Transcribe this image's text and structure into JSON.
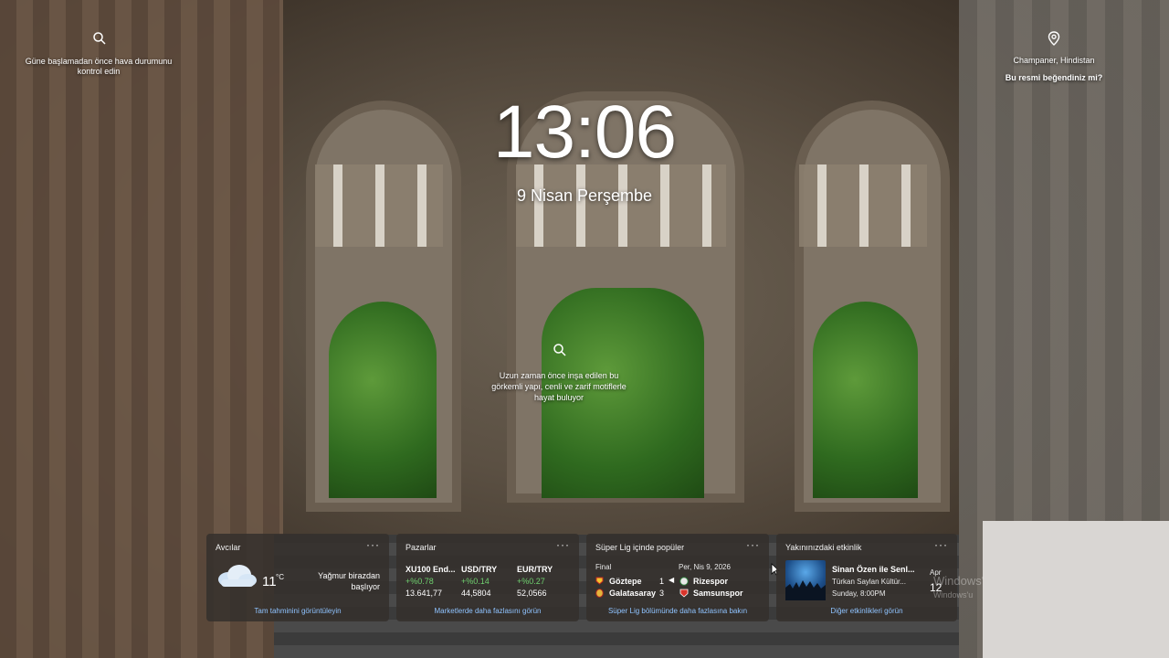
{
  "left_hint": {
    "icon": "search-icon",
    "text_line1": "Güne başlamadan önce hava durumunu",
    "text_line2": "kontrol edin"
  },
  "right_hint": {
    "icon": "location-pin-icon",
    "location": "Champaner, Hindistan",
    "question": "Bu resmi beğendiniz mi?"
  },
  "center_hint": {
    "icon": "search-icon",
    "line1": "Uzun zaman önce inşa edilen bu",
    "line2": "görkemli yapı, cenli ve zarif motiflerle",
    "line3": "hayat buluyor"
  },
  "clock": {
    "time": "13:06",
    "date": "9 Nisan Perşembe"
  },
  "cards": {
    "weather": {
      "title": "Avcılar",
      "more": "···",
      "temp": "11",
      "unit": "°C",
      "cond_line1": "Yağmur birazdan",
      "cond_line2": "başlıyor",
      "icon": "cloud-icon",
      "link": "Tam tahminini görüntüleyin"
    },
    "markets": {
      "title": "Pazarlar",
      "more": "···",
      "items": [
        {
          "name": "XU100 End...",
          "change": "+%0.78",
          "value": "13.641,77"
        },
        {
          "name": "USD/TRY",
          "change": "+%0.14",
          "value": "44,5804"
        },
        {
          "name": "EUR/TRY",
          "change": "+%0.27",
          "value": "52,0566"
        }
      ],
      "link": "Marketlerde daha fazlasını görün"
    },
    "football": {
      "title": "Süper Lig içinde popüler",
      "more": "···",
      "status": "Final",
      "date": "Per, Nis 9, 2026",
      "home1": "Göztepe",
      "score1": "1",
      "away1": "Rizespor",
      "home2": "Galatasaray",
      "score2": "3",
      "away2": "Samsunspor",
      "link": "Süper Lig bölümünde daha fazlasına bakın"
    },
    "events": {
      "title": "Yakınınızdaki etkinlik",
      "more": "···",
      "event_title": "Sinan Özen ile Senl...",
      "venue": "Türkan Saylan Kültür...",
      "time": "Sunday, 8:00PM",
      "next_month": "Apr",
      "next_day": "12",
      "link": "Diğer etkinlikleri görün"
    }
  },
  "watermark": {
    "line1": "Windows'",
    "line2": "Windows'u"
  }
}
